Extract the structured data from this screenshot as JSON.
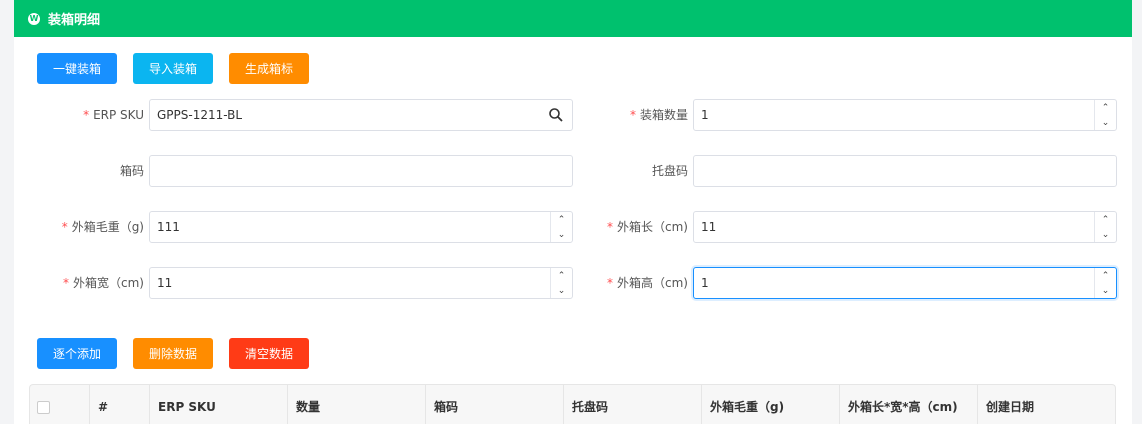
{
  "header": {
    "title": "装箱明细",
    "icon": "logo-icon"
  },
  "top_buttons": {
    "one_click": "一键装箱",
    "import": "导入装箱",
    "generate": "生成箱标"
  },
  "form": {
    "erp_sku": {
      "label": "ERP SKU",
      "value": "GPPS-1211-BL",
      "required": true
    },
    "qty": {
      "label": "装箱数量",
      "value": "1",
      "required": true
    },
    "box_code": {
      "label": "箱码",
      "value": ""
    },
    "pallet_code": {
      "label": "托盘码",
      "value": ""
    },
    "gross_weight": {
      "label": "外箱毛重（g)",
      "value": "111",
      "required": true
    },
    "length": {
      "label": "外箱长（cm)",
      "value": "11",
      "required": true
    },
    "width": {
      "label": "外箱宽（cm)",
      "value": "11",
      "required": true
    },
    "height": {
      "label": "外箱高（cm)",
      "value": "1",
      "required": true
    }
  },
  "action_buttons": {
    "add": "逐个添加",
    "delete": "删除数据",
    "clear": "清空数据"
  },
  "table": {
    "columns": [
      "#",
      "ERP SKU",
      "数量",
      "箱码",
      "托盘码",
      "外箱毛重（g)",
      "外箱长*宽*高（cm)",
      "创建日期"
    ]
  },
  "colors": {
    "header_bg": "#00c16e",
    "primary": "#1890ff",
    "cyan": "#0bb5f0",
    "orange": "#ff8c00",
    "red": "#ff3b16"
  }
}
